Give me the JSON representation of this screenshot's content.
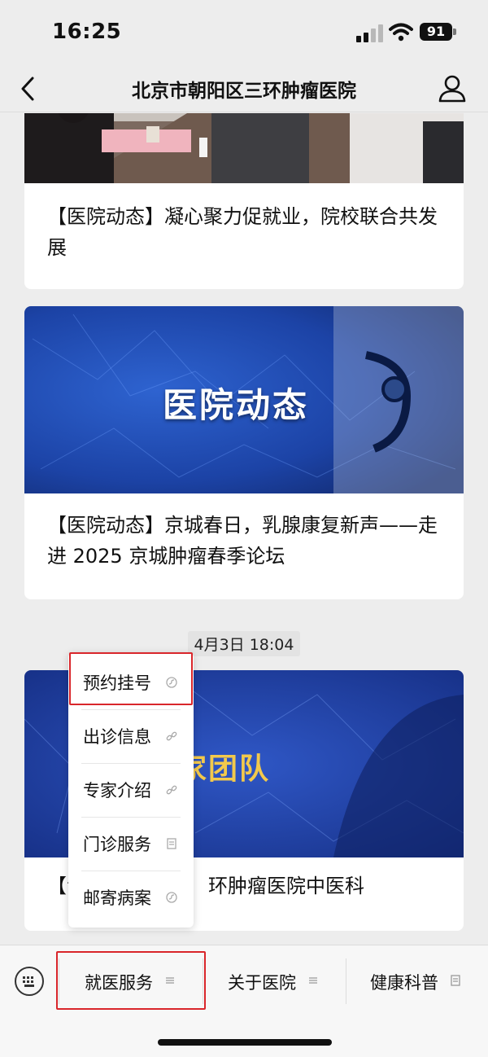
{
  "status_bar": {
    "time": "16:25",
    "battery": "91"
  },
  "nav": {
    "title": "北京市朝阳区三环肿瘤医院",
    "back_icon": "chevron-left-icon",
    "profile_icon": "person-icon"
  },
  "feed": {
    "cards": [
      {
        "title": "【医院动态】凝心聚力促就业，院校联合共发展"
      },
      {
        "title": "【医院动态】京城春日，乳腺康复新声——走进 2025 京城肿瘤春季论坛",
        "image_text": "医院动态"
      },
      {
        "title_prefix": "【专",
        "title_suffix": "环肿瘤医院中医科",
        "image_text": "专家团队"
      }
    ],
    "timestamp": "4月3日 18:04"
  },
  "popup_menu": {
    "items": [
      {
        "label": "预约挂号",
        "icon": "mini-program-icon"
      },
      {
        "label": "出诊信息",
        "icon": "link-icon"
      },
      {
        "label": "专家介绍",
        "icon": "link-icon"
      },
      {
        "label": "门诊服务",
        "icon": "article-icon"
      },
      {
        "label": "邮寄病案",
        "icon": "mini-program-icon"
      }
    ]
  },
  "bottom_bar": {
    "keyboard_icon": "keyboard-icon",
    "tabs": [
      {
        "label": "就医服务",
        "icon": "menu-lines-icon"
      },
      {
        "label": "关于医院",
        "icon": "menu-lines-icon"
      },
      {
        "label": "健康科普",
        "icon": "article-icon"
      }
    ]
  },
  "colors": {
    "background": "#ededed",
    "highlight": "#d9262b",
    "banner_blue": "#1f4bb0"
  }
}
